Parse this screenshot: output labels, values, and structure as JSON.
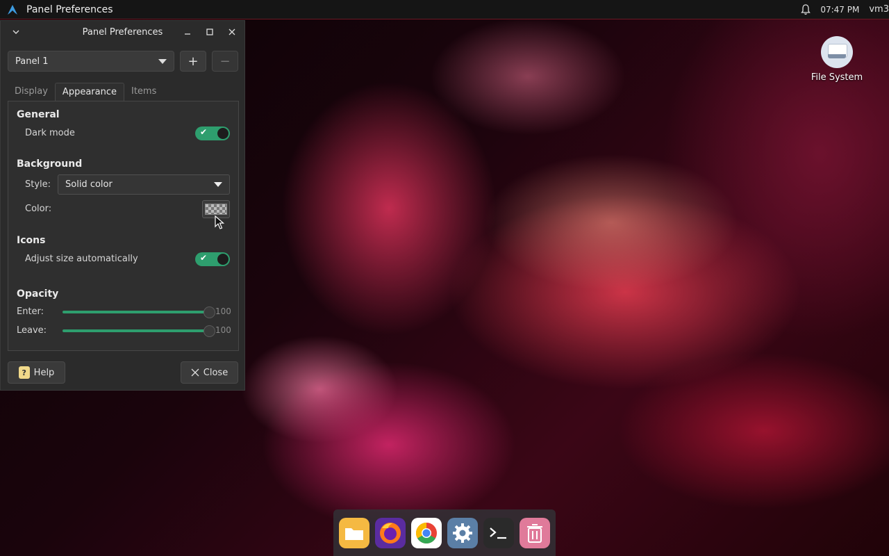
{
  "topbar": {
    "title": "Panel Preferences",
    "time": "07:47 PM",
    "user": "vm3"
  },
  "window": {
    "title": "Panel Preferences",
    "panel_select": "Panel 1",
    "add_label": "+",
    "remove_label": "−",
    "tabs": [
      {
        "label": "Display"
      },
      {
        "label": "Appearance"
      },
      {
        "label": "Items"
      }
    ],
    "active_tab": "Appearance",
    "general": {
      "heading": "General",
      "dark_mode_label": "Dark mode",
      "dark_mode_on": true
    },
    "background": {
      "heading": "Background",
      "style_label": "Style:",
      "style_value": "Solid color",
      "color_label": "Color:"
    },
    "icons": {
      "heading": "Icons",
      "adjust_label": "Adjust size automatically",
      "adjust_on": true
    },
    "opacity": {
      "heading": "Opacity",
      "enter_label": "Enter:",
      "enter_value": "100",
      "leave_label": "Leave:",
      "leave_value": "100"
    },
    "help_label": "Help",
    "close_label": "Close"
  },
  "desktop": {
    "icons": [
      {
        "label": "File System",
        "icon": "drive-icon"
      }
    ]
  },
  "dock": {
    "items": [
      {
        "icon": "files-icon",
        "color": "#f5b942"
      },
      {
        "icon": "firefox-icon",
        "color": "#5a2ca0"
      },
      {
        "icon": "chrome-icon",
        "color": "#ffffff"
      },
      {
        "icon": "settings-icon",
        "color": "#5b7fa6"
      },
      {
        "icon": "terminal-icon",
        "color": "#2a2a2a"
      },
      {
        "icon": "trash-icon",
        "color": "#e07a9a"
      }
    ]
  },
  "colors": {
    "accent": "#2e9e6e",
    "window_bg": "#2b2b2b"
  }
}
